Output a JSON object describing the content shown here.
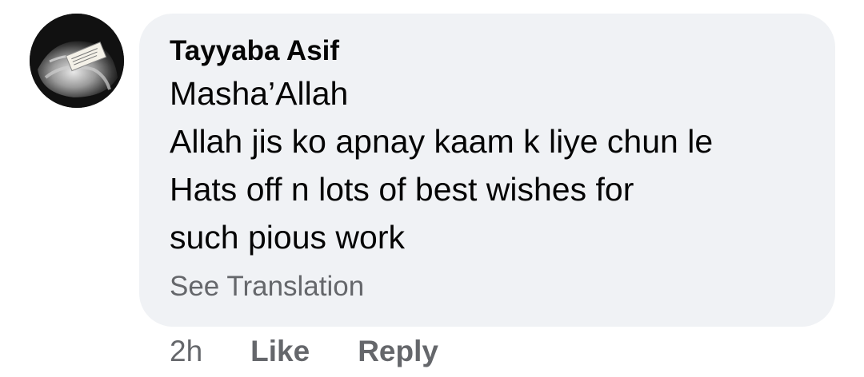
{
  "comment": {
    "author": "Tayyaba Asif",
    "avatar_icon": "profile-photo-avatar",
    "body_lines": [
      "Masha’Allah",
      "Allah jis ko apnay kaam k liye chun le",
      "Hats off n lots of best wishes for",
      "such pious work"
    ],
    "see_translation_label": "See Translation"
  },
  "actions": {
    "timestamp": "2h",
    "like_label": "Like",
    "reply_label": "Reply"
  },
  "colors": {
    "bubble_background": "#f0f2f5",
    "primary_text": "#050505",
    "secondary_text": "#65676b"
  }
}
